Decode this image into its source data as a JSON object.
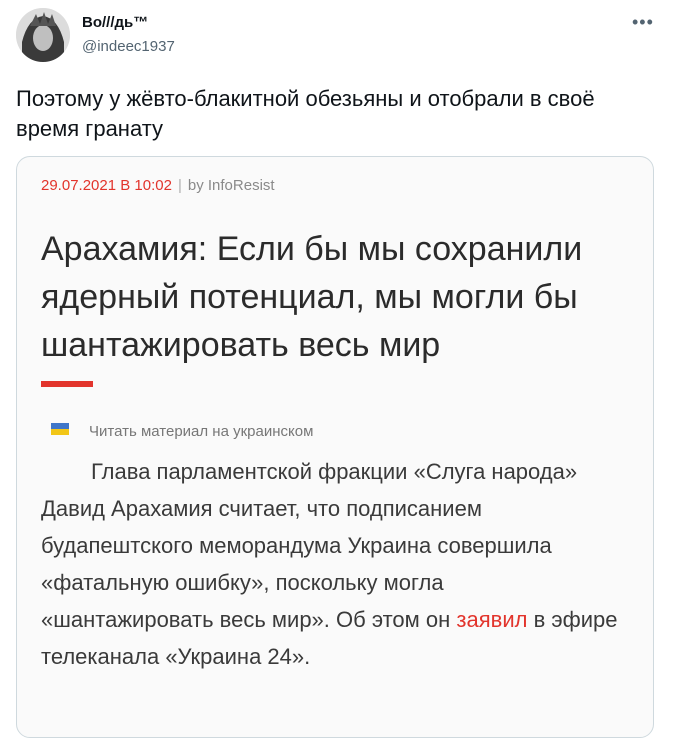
{
  "author": {
    "name": "Во///дь™",
    "handle": "@indeec1937"
  },
  "tweet": {
    "text": "Поэтому у жёвто-блакитной обезьяны и отобрали в своё время гранату"
  },
  "card": {
    "date": "29.07.2021 В 10:02",
    "separator": "|",
    "byline": "by InfoResist",
    "headline": "Арахамия: Если бы мы сохранили ядерный потенциал, мы могли бы шантажировать весь мир",
    "read_ua": "Читать материал на украинском",
    "body_before": "Глава парламентской фракции «Слуга народа» Давид Арахамия считает, что подписанием будапештского меморандума Украина совершила «фатальную ошибку», поскольку могла «шантажировать весь мир». Об этом он ",
    "body_link": "заявил",
    "body_after": " в эфире телеканала «Украина 24»."
  },
  "colors": {
    "accent_red": "#e2342c",
    "flag_blue": "#3f76c9",
    "flag_yellow": "#f2c617"
  },
  "icons": {
    "more": "more-options-icon",
    "flag": "ukraine-flag-icon"
  }
}
